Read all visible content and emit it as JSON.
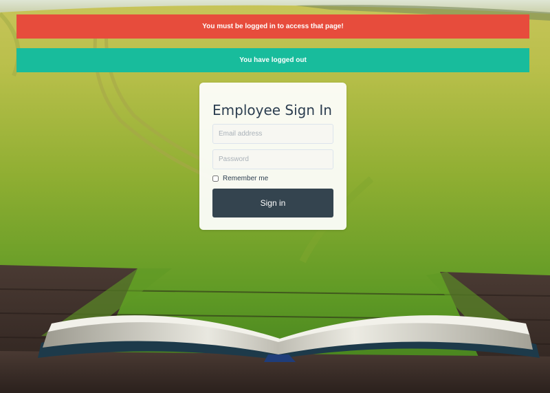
{
  "alerts": {
    "danger": "You must be logged in to access that page!",
    "success": "You have logged out"
  },
  "login": {
    "title": "Employee Sign In",
    "email_placeholder": "Email address",
    "password_placeholder": "Password",
    "remember_label": "Remember me",
    "submit_label": "Sign in"
  },
  "colors": {
    "danger": "#e74c3c",
    "success": "#18bc9c",
    "button": "#34444f",
    "title": "#2c3e50"
  }
}
